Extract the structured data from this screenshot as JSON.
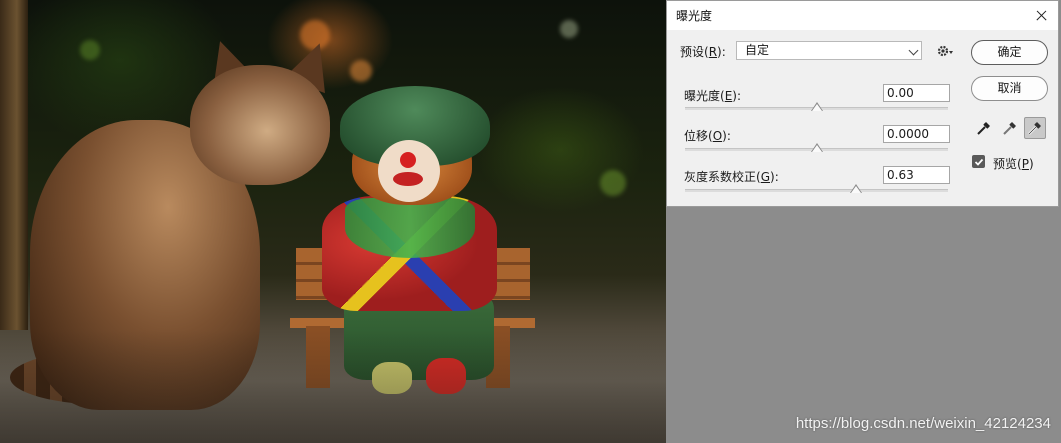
{
  "dialog": {
    "title": "曝光度",
    "preset": {
      "label": "预设",
      "mnemonic": "R",
      "value": "自定"
    },
    "exposure": {
      "label": "曝光度",
      "mnemonic": "E",
      "value": "0.00",
      "slider_fraction": 0.5
    },
    "offset": {
      "label": "位移",
      "mnemonic": "O",
      "value": "0.0000",
      "slider_fraction": 0.5
    },
    "gamma": {
      "label": "灰度系数校正",
      "mnemonic": "G",
      "value": "0.63",
      "slider_fraction": 0.65
    },
    "ok_label": "确定",
    "cancel_label": "取消",
    "preview": {
      "label": "预览",
      "mnemonic": "P",
      "checked": true
    },
    "eyedroppers": [
      "black-point",
      "gray-point",
      "white-point"
    ],
    "selected_eyedropper": "white-point"
  },
  "watermark": "https://blog.csdn.net/weixin_42124234",
  "colors": {
    "dialog_bg": "#f0f0f0",
    "canvas_bg": "#8c8c8c",
    "checkbox": "#5a5a5a"
  }
}
